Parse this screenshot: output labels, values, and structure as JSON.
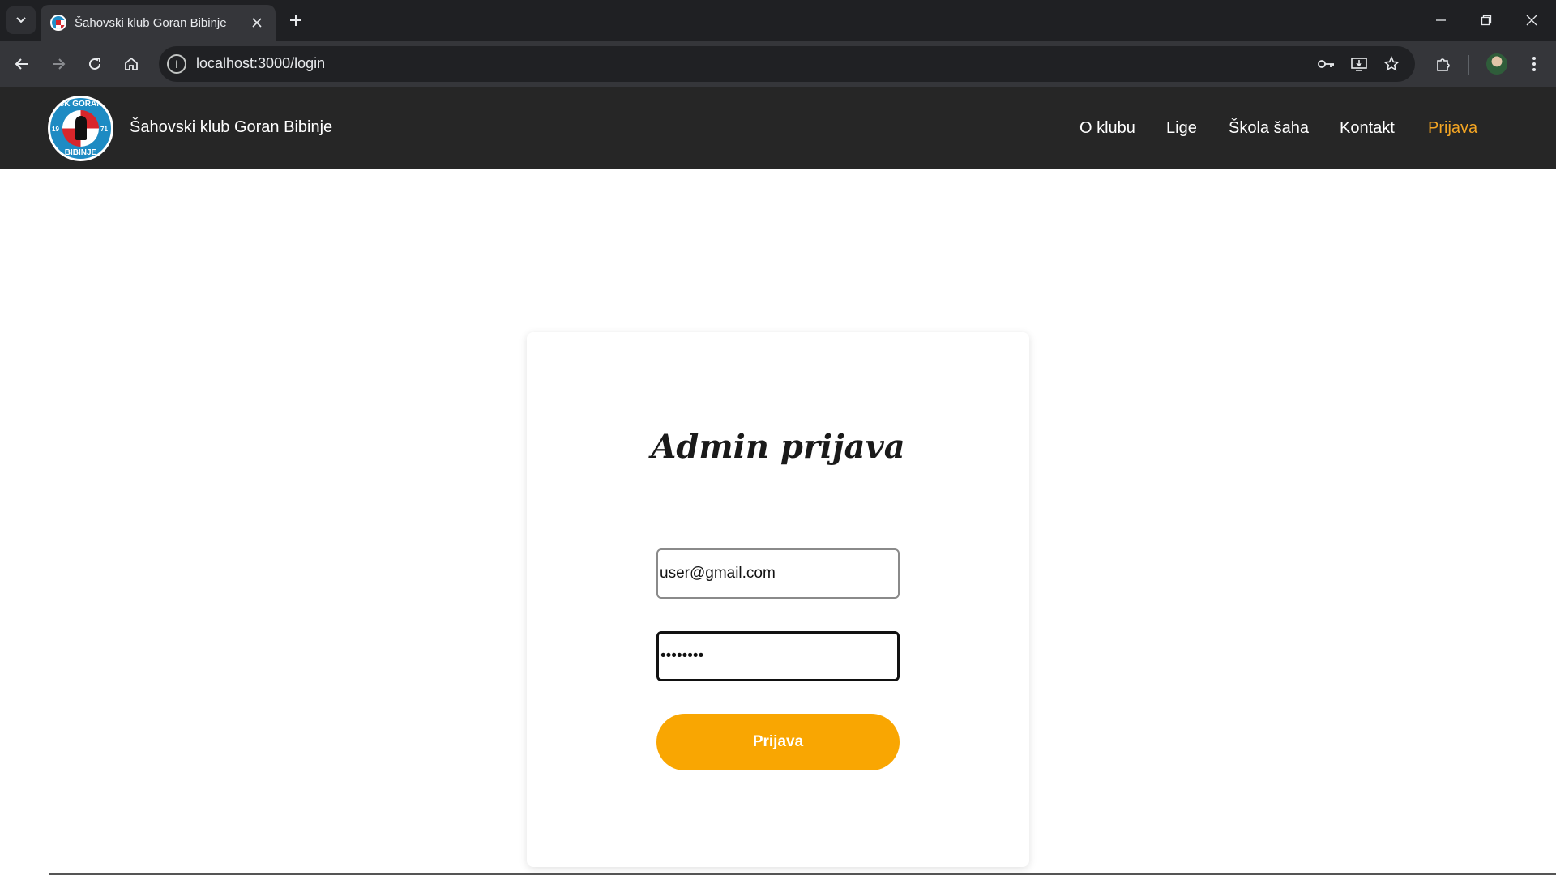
{
  "browser": {
    "tab_title": "Šahovski klub Goran Bibinje",
    "url": "localhost:3000/login",
    "icons": {
      "tab_search": "chevron-down-icon",
      "tab_close": "close-icon",
      "new_tab": "plus-icon",
      "back": "arrow-left-icon",
      "forward": "arrow-right-icon",
      "reload": "reload-icon",
      "home": "home-icon",
      "site_info": "info-icon",
      "password": "key-icon",
      "install": "install-icon",
      "bookmark": "star-icon",
      "extensions": "puzzle-icon",
      "menu": "more-vert-icon"
    }
  },
  "site": {
    "title": "Šahovski klub Goran Bibinje",
    "logo_text_top": "ŠK GORAN",
    "logo_text_bottom": "BIBINJE",
    "logo_year_left": "19",
    "logo_year_right": "71",
    "nav": [
      {
        "label": "O klubu"
      },
      {
        "label": "Lige"
      },
      {
        "label": "Škola šaha"
      },
      {
        "label": "Kontakt"
      },
      {
        "label": "Prijava",
        "active": true
      }
    ],
    "accent_color": "#f5a623"
  },
  "login": {
    "heading": "Admin prijava",
    "email_value": "user@gmail.com",
    "password_value": "••••••••",
    "submit_label": "Prijava",
    "button_color": "#f9a602"
  }
}
